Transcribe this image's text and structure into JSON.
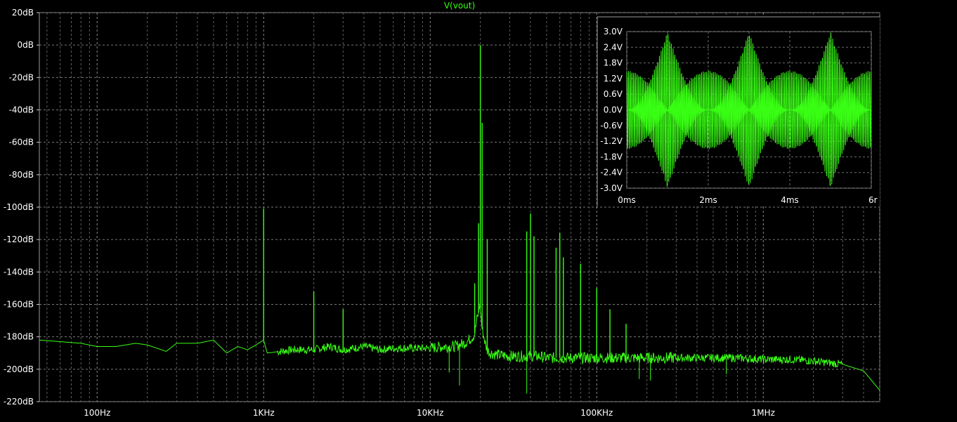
{
  "chart_data": [
    {
      "type": "line",
      "title": "V(vout)",
      "xscale": "log",
      "x_ticks": [
        {
          "value": 100,
          "label": "100Hz"
        },
        {
          "value": 1000,
          "label": "1KHz"
        },
        {
          "value": 10000,
          "label": "10KHz"
        },
        {
          "value": 100000,
          "label": "100KHz"
        },
        {
          "value": 1000000,
          "label": "1MHz"
        }
      ],
      "y_ticks": [
        {
          "value": 20,
          "label": "20dB"
        },
        {
          "value": 0,
          "label": "0dB"
        },
        {
          "value": -20,
          "label": "-20dB"
        },
        {
          "value": -40,
          "label": "-40dB"
        },
        {
          "value": -60,
          "label": "-60dB"
        },
        {
          "value": -80,
          "label": "-80dB"
        },
        {
          "value": -100,
          "label": "-100dB"
        },
        {
          "value": -120,
          "label": "-120dB"
        },
        {
          "value": -140,
          "label": "-140dB"
        },
        {
          "value": -160,
          "label": "-160dB"
        },
        {
          "value": -180,
          "label": "-180dB"
        },
        {
          "value": -200,
          "label": "-200dB"
        },
        {
          "value": -220,
          "label": "-220dB"
        }
      ],
      "xlim": [
        45,
        5000000
      ],
      "ylim": [
        -220,
        20
      ],
      "grid": true,
      "series": [
        {
          "name": "V(vout)",
          "color": "#39ff14",
          "x": [
            45,
            60,
            80,
            100,
            130,
            170,
            200,
            260,
            300,
            400,
            500,
            600,
            700,
            800,
            900,
            1000,
            1050,
            1500,
            2000,
            2500,
            3000,
            4000,
            5000,
            6000,
            8000,
            10000,
            12000,
            14000,
            16000,
            17000,
            18000,
            18500,
            19000,
            19500,
            19800,
            20000,
            20200,
            20500,
            21000,
            21500,
            22000,
            23000,
            25000,
            30000,
            35000,
            40000,
            45000,
            50000,
            60000,
            70000,
            80000,
            90000,
            100000,
            120000,
            150000,
            200000,
            300000,
            400000,
            500000,
            700000,
            1000000,
            1500000,
            2000000,
            3000000,
            4000000,
            5000000
          ],
          "y": [
            -182,
            -183,
            -184,
            -186,
            -186,
            -184,
            -185,
            -189,
            -184,
            -184,
            -182,
            -190,
            -186,
            -188,
            -185,
            -182,
            -190,
            -188,
            -188,
            -186,
            -188,
            -186,
            -188,
            -187,
            -187,
            -187,
            -186,
            -186,
            -184,
            -182,
            -180,
            -178,
            -170,
            -165,
            -160,
            -162,
            -168,
            -175,
            -180,
            -185,
            -188,
            -190,
            -191,
            -192,
            -192,
            -192,
            -192,
            -193,
            -193,
            -193,
            -193,
            -193,
            -193,
            -193,
            -193,
            -193,
            -193,
            -193,
            -193,
            -193,
            -194,
            -194,
            -195,
            -197,
            -201,
            -213
          ]
        }
      ],
      "peaks": [
        {
          "x": 1000,
          "y": -101
        },
        {
          "x": 2000,
          "y": -152
        },
        {
          "x": 3000,
          "y": -163
        },
        {
          "x": 18500,
          "y": -147
        },
        {
          "x": 19500,
          "y": -110
        },
        {
          "x": 20000,
          "y": 0
        },
        {
          "x": 20500,
          "y": -48
        },
        {
          "x": 22000,
          "y": -120
        },
        {
          "x": 38000,
          "y": -115
        },
        {
          "x": 40000,
          "y": -104
        },
        {
          "x": 42000,
          "y": -118
        },
        {
          "x": 57000,
          "y": -125
        },
        {
          "x": 60000,
          "y": -116
        },
        {
          "x": 63000,
          "y": -131
        },
        {
          "x": 80000,
          "y": -135
        },
        {
          "x": 100000,
          "y": -150
        },
        {
          "x": 120000,
          "y": -163
        },
        {
          "x": 150000,
          "y": -172
        }
      ],
      "dips": [
        {
          "x": 13000,
          "y": -202
        },
        {
          "x": 15000,
          "y": -210
        },
        {
          "x": 38000,
          "y": -215
        },
        {
          "x": 180000,
          "y": -206
        },
        {
          "x": 210000,
          "y": -207
        },
        {
          "x": 600000,
          "y": -203
        }
      ]
    },
    {
      "type": "line",
      "title": "",
      "x_ticks": [
        {
          "value": 0,
          "label": "0ms"
        },
        {
          "value": 2,
          "label": "2ms"
        },
        {
          "value": 4,
          "label": "4ms"
        },
        {
          "value": 6,
          "label": "6r"
        }
      ],
      "y_ticks": [
        {
          "value": 3.0,
          "label": "3.0V"
        },
        {
          "value": 2.4,
          "label": "2.4V"
        },
        {
          "value": 1.8,
          "label": "1.8V"
        },
        {
          "value": 1.2,
          "label": "1.2V"
        },
        {
          "value": 0.6,
          "label": "0.6V"
        },
        {
          "value": 0.0,
          "label": "0.0V"
        },
        {
          "value": -0.6,
          "label": "-0.6V"
        },
        {
          "value": -1.2,
          "label": "-1.2V"
        },
        {
          "value": -1.8,
          "label": "-1.8V"
        },
        {
          "value": -2.4,
          "label": "-2.4V"
        },
        {
          "value": -3.0,
          "label": "-3.0V"
        }
      ],
      "xlim": [
        0,
        6
      ],
      "ylim": [
        -3,
        3
      ],
      "grid": true,
      "series": [
        {
          "color": "#39ff14",
          "carrier_khz": 20,
          "envelope_period_ms": 2,
          "peak_amplitude_v": 3.0,
          "center_envelope_v": 1.5
        }
      ]
    }
  ]
}
